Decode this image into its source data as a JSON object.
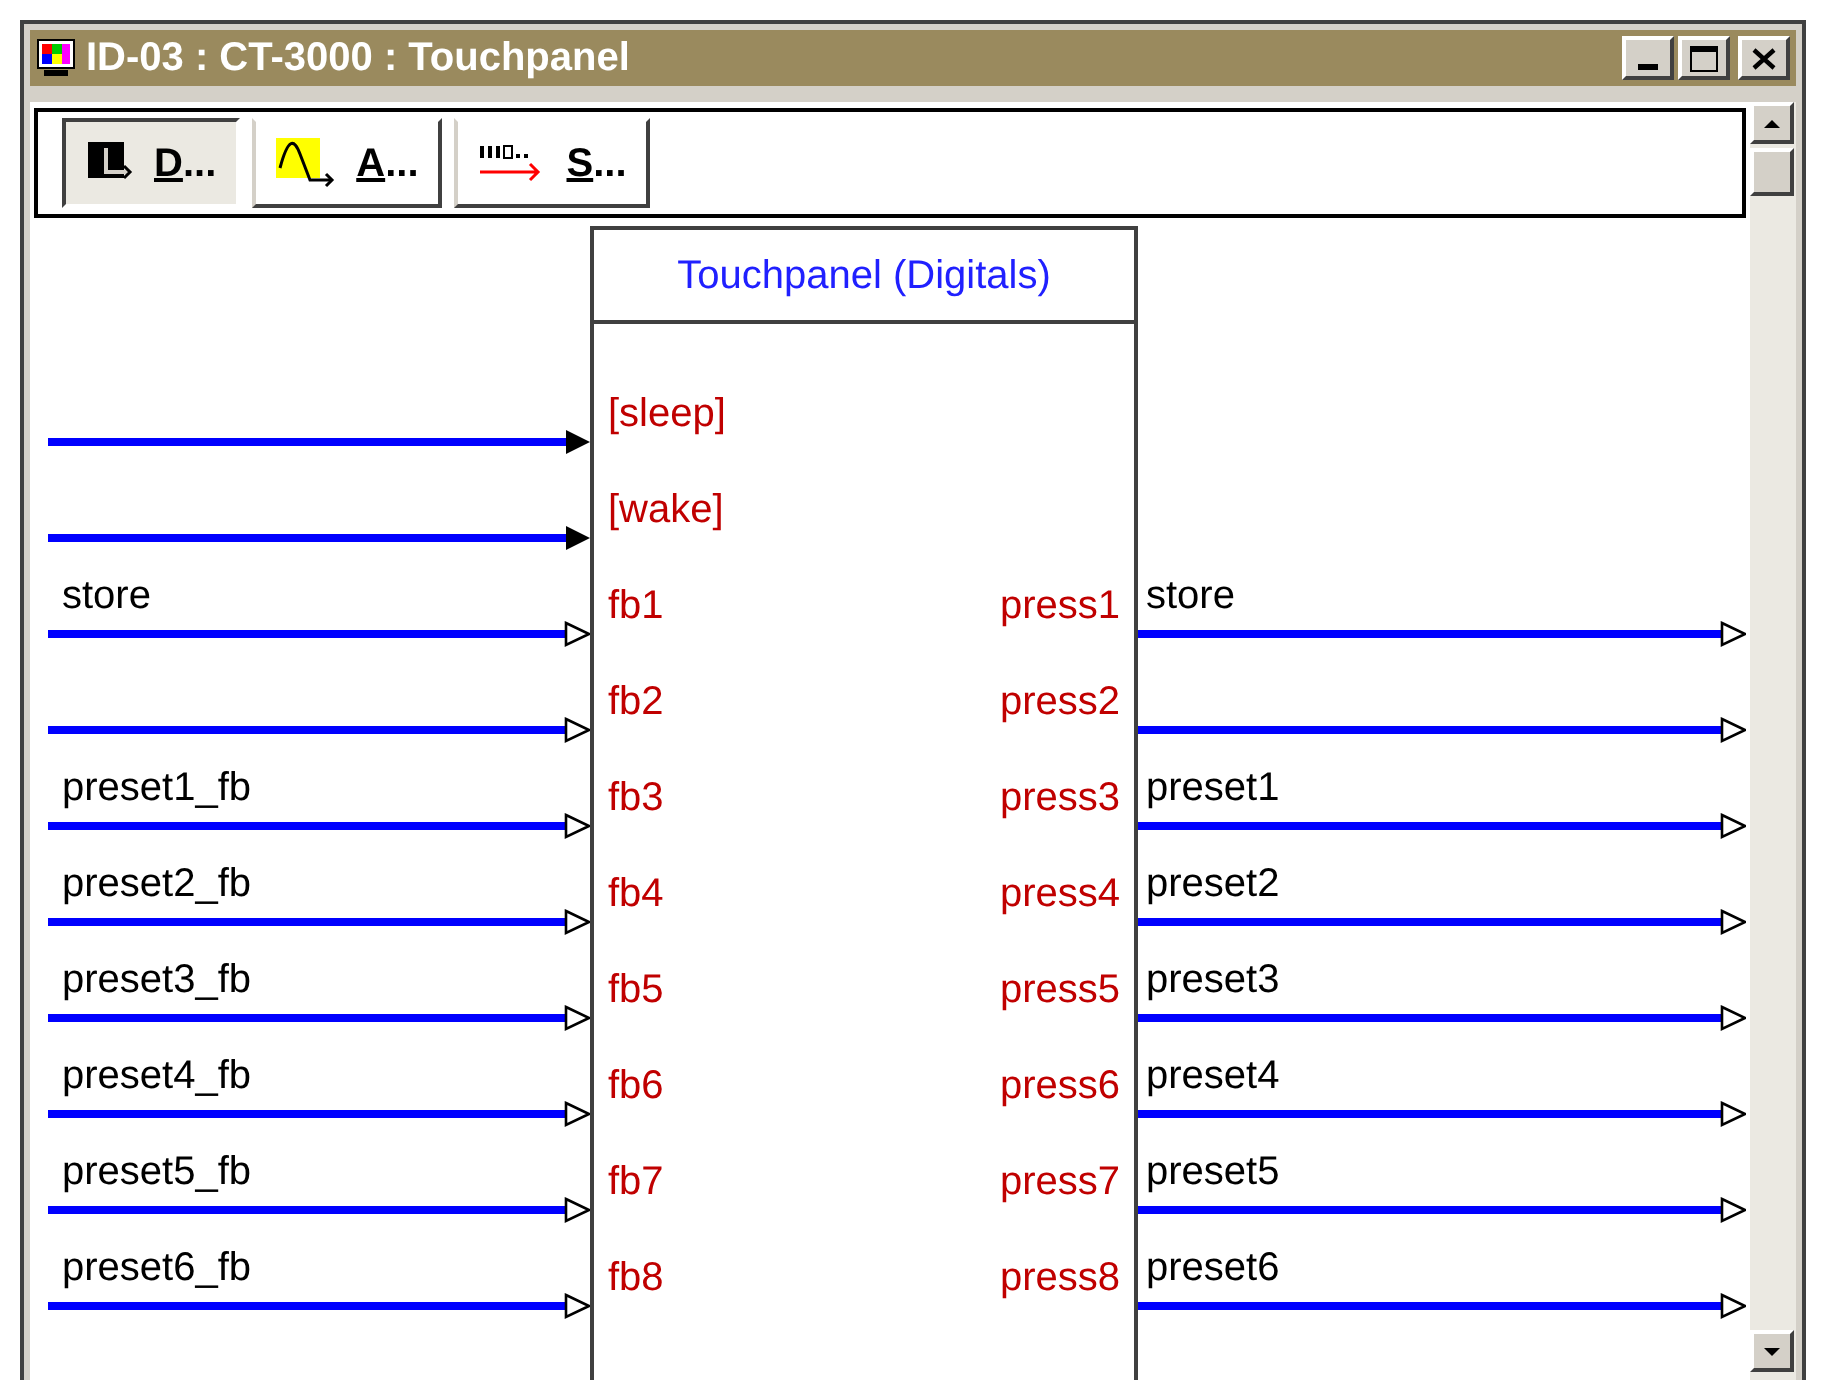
{
  "window": {
    "title": "ID-03 : CT-3000 : Touchpanel"
  },
  "toolbar": [
    {
      "kind": "digital",
      "label": "D...",
      "selected": true
    },
    {
      "kind": "analog",
      "label": "A...",
      "selected": false
    },
    {
      "kind": "serial",
      "label": "S...",
      "selected": false
    }
  ],
  "block": {
    "title": "Touchpanel (Digitals)",
    "rows": [
      {
        "kind": "trigger",
        "input_port": "[sleep]"
      },
      {
        "kind": "trigger",
        "input_port": "[wake]"
      },
      {
        "kind": "io",
        "input_signal": "store",
        "input_port": "fb1",
        "output_port": "press1",
        "output_signal": "store"
      },
      {
        "kind": "io",
        "input_port": "fb2",
        "output_port": "press2"
      },
      {
        "kind": "io",
        "input_signal": "preset1_fb",
        "input_port": "fb3",
        "output_port": "press3",
        "output_signal": "preset1"
      },
      {
        "kind": "io",
        "input_signal": "preset2_fb",
        "input_port": "fb4",
        "output_port": "press4",
        "output_signal": "preset2"
      },
      {
        "kind": "io",
        "input_signal": "preset3_fb",
        "input_port": "fb5",
        "output_port": "press5",
        "output_signal": "preset3"
      },
      {
        "kind": "io",
        "input_signal": "preset4_fb",
        "input_port": "fb6",
        "output_port": "press6",
        "output_signal": "preset4"
      },
      {
        "kind": "io",
        "input_signal": "preset5_fb",
        "input_port": "fb7",
        "output_port": "press7",
        "output_signal": "preset5"
      },
      {
        "kind": "io",
        "input_signal": "preset6_fb",
        "input_port": "fb8",
        "output_port": "press8",
        "output_signal": "preset6"
      }
    ]
  }
}
